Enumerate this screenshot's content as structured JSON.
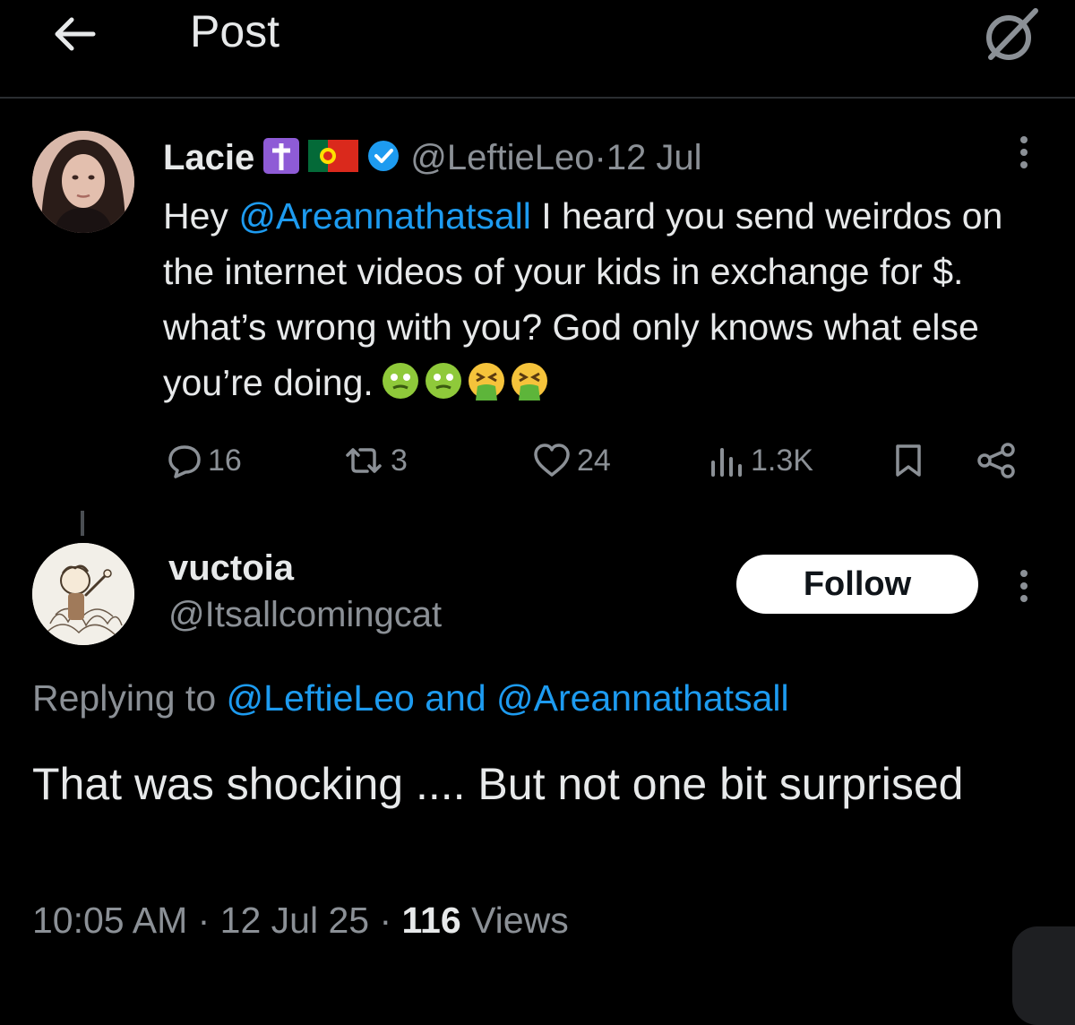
{
  "header": {
    "title": "Post",
    "back_icon": "arrow-left-icon",
    "grok_icon": "slash-circle-icon"
  },
  "tweet": {
    "author_name": "Lacie",
    "badges": [
      "latin-cross-emoji",
      "portugal-flag-emoji",
      "verified-badge-icon"
    ],
    "handle": "@LeftieLeo",
    "date_sep": " · ",
    "date": "12 Jul",
    "text": {
      "prefix": "Hey ",
      "mention": "@Areannathatsall",
      "body": " I heard you send weirdos on the internet videos of your kids in exchange for $. what’s wrong with you? God only knows what else you’re doing.",
      "emojis": [
        "woozy-face-emoji",
        "woozy-face-emoji",
        "vomiting-face-emoji",
        "vomiting-face-emoji"
      ]
    },
    "stats": {
      "replies": "16",
      "reposts": "3",
      "likes": "24",
      "views": "1.3K"
    }
  },
  "reply": {
    "author_name": "vuctoia",
    "handle": "@Itsallcomingcat",
    "follow_label": "Follow",
    "replying_prefix": "Replying to ",
    "replying_handle1": "@LeftieLeo",
    "replying_and": " and ",
    "replying_handle2": "@Areannathatsall",
    "text": "That was shocking .... But not one bit surprised",
    "time": "10:05 AM",
    "sep1": " · ",
    "date": "12 Jul 25",
    "sep2": " · ",
    "views_count": "116",
    "views_label": " Views"
  },
  "colors": {
    "background": "#000000",
    "text": "#e7e9ea",
    "muted": "#8b9096",
    "accent": "#1d9bf0"
  }
}
